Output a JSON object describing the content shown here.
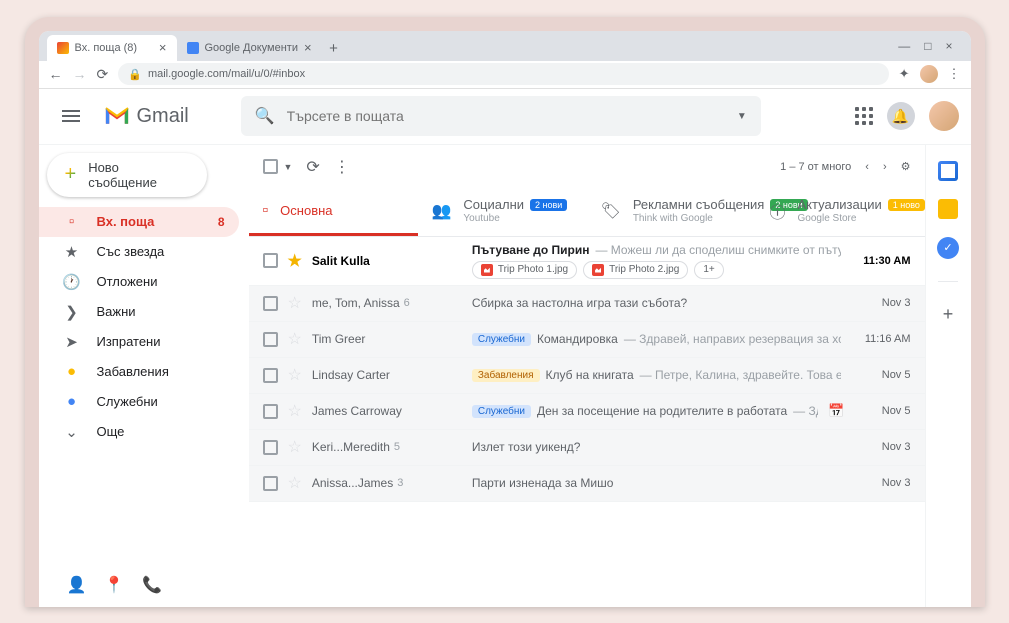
{
  "browser": {
    "tabs": [
      {
        "title": "Вх. поща (8)",
        "favicon": "gmail"
      },
      {
        "title": "Google Документи",
        "favicon": "docs"
      }
    ],
    "url": "mail.google.com/mail/u/0/#inbox"
  },
  "header": {
    "product": "Gmail",
    "search_placeholder": "Търсете в пощата"
  },
  "compose": {
    "label": "Ново съобщение"
  },
  "nav": [
    {
      "icon": "inbox",
      "label": "Вх. поща",
      "count": "8",
      "active": true
    },
    {
      "icon": "star",
      "label": "Със звезда"
    },
    {
      "icon": "clock",
      "label": "Отложени"
    },
    {
      "icon": "important",
      "label": "Важни"
    },
    {
      "icon": "sent",
      "label": "Изпратени"
    },
    {
      "icon": "fun",
      "label": "Забавления"
    },
    {
      "icon": "work",
      "label": "Служебни"
    },
    {
      "icon": "more",
      "label": "Още"
    }
  ],
  "toolbar": {
    "range": "1 – 7 от много"
  },
  "categories": [
    {
      "icon": "inbox",
      "label": "Основна",
      "active": true
    },
    {
      "icon": "people",
      "label": "Социални",
      "badge": "2 нови",
      "badge_class": "blue",
      "sub": "Youtube"
    },
    {
      "icon": "tag",
      "label": "Рекламни съобщения",
      "badge": "2 нови",
      "badge_class": "green",
      "sub": "Think with Google"
    },
    {
      "icon": "info",
      "label": "Актуализации",
      "badge": "1 ново",
      "badge_class": "orange",
      "sub": "Google Store"
    }
  ],
  "emails": [
    {
      "unread": true,
      "starred": true,
      "sender": "Salit Kulla",
      "subject": "Пътуване до Пирин",
      "snippet": "Можеш ли да споделиш снимките от пътуването ни?",
      "date": "11:30 AM",
      "attachments": [
        "Trip Photo 1.jpg",
        "Trip Photo 2.jpg"
      ],
      "attach_more": "1+"
    },
    {
      "unread": false,
      "sender": "me, Tom, Anissa",
      "sender_count": "6",
      "subject": "Сбирка за настолна игра тази събота?",
      "date": "Nov 3"
    },
    {
      "unread": false,
      "sender": "Tim Greer",
      "label": "Служебни",
      "label_class": "work",
      "subject": "Командировка",
      "snippet": "Здравей, направих резервация за хотела",
      "date": "11:16 AM"
    },
    {
      "unread": false,
      "sender": "Lindsay Carter",
      "label": "Забавления",
      "label_class": "fun",
      "subject": "Клуб на книгата",
      "snippet": "Петре, Калина, здравейте. Това е списъкът с...",
      "date": "Nov 5"
    },
    {
      "unread": false,
      "sender": "James Carroway",
      "label": "Служебни",
      "label_class": "work",
      "subject": "Ден за посещение на родителите в работата",
      "snippet": "Здравейте...",
      "date": "Nov 5",
      "has_event": true
    },
    {
      "unread": false,
      "sender": "Keri...Meredith",
      "sender_count": "5",
      "subject": "Излет този уикенд?",
      "date": "Nov 3"
    },
    {
      "unread": false,
      "sender": "Anissa...James",
      "sender_count": "3",
      "subject": "Парти изненада за Мишо",
      "date": "Nov 3"
    }
  ]
}
